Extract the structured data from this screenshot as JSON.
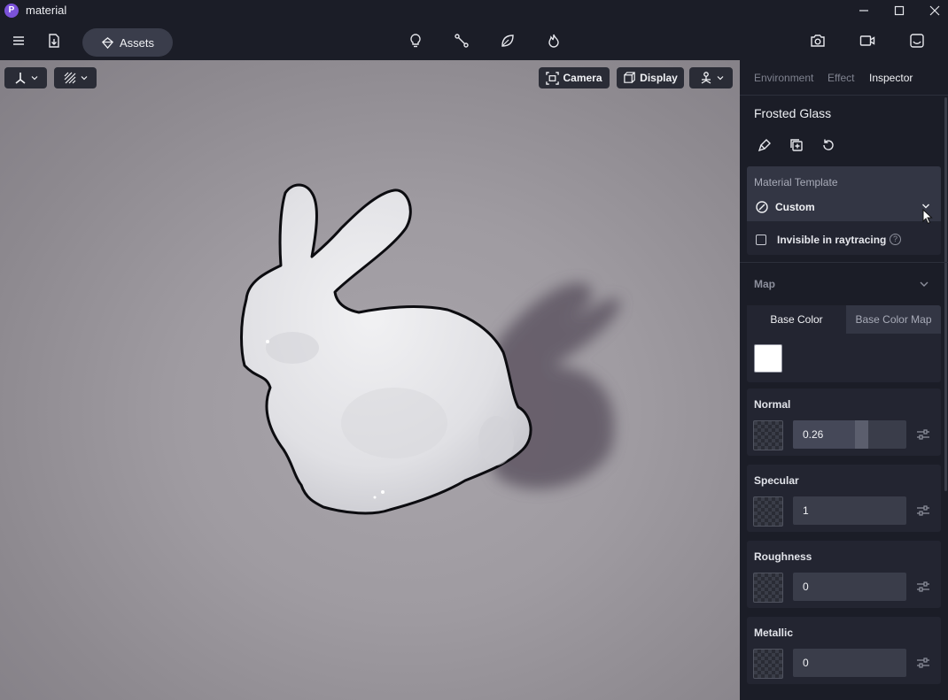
{
  "app": {
    "logo_letter": "P",
    "title": "material"
  },
  "toolbar": {
    "assets_label": "Assets"
  },
  "viewport": {
    "camera_label": "Camera",
    "display_label": "Display"
  },
  "panel": {
    "tabs": [
      {
        "label": "Environment",
        "active": false
      },
      {
        "label": "Effect",
        "active": false
      },
      {
        "label": "Inspector",
        "active": true
      }
    ],
    "material_name": "Frosted Glass",
    "template": {
      "label": "Material Template",
      "value": "Custom"
    },
    "raytracing": {
      "label": "Invisible in raytracing",
      "checked": false,
      "help": "?"
    },
    "map": {
      "header": "Map",
      "base_tabs": [
        "Base Color",
        "Base Color Map"
      ],
      "base_color": "#ffffff"
    },
    "properties": [
      {
        "label": "Normal",
        "value": "0.26",
        "fraction": 0.26
      },
      {
        "label": "Specular",
        "value": "1"
      },
      {
        "label": "Roughness",
        "value": "0"
      },
      {
        "label": "Metallic",
        "value": "0"
      }
    ]
  }
}
